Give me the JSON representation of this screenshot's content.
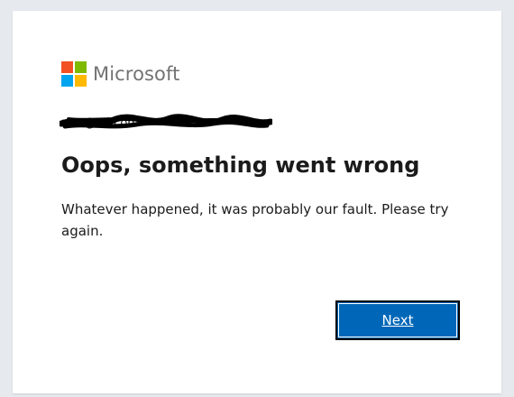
{
  "brand": {
    "name": "Microsoft",
    "logo_colors": [
      "#f25022",
      "#7fba00",
      "#00a4ef",
      "#ffb900"
    ]
  },
  "account": {
    "email": "m...@...l.com",
    "redacted": true
  },
  "error": {
    "title": "Oops, something went wrong",
    "message": "Whatever happened, it was probably our fault. Please try again."
  },
  "actions": {
    "next_label": "Next"
  },
  "colors": {
    "primary": "#0067b8",
    "text": "#1b1b1b",
    "brand_text": "#737373",
    "background": "#e6e9ee"
  }
}
